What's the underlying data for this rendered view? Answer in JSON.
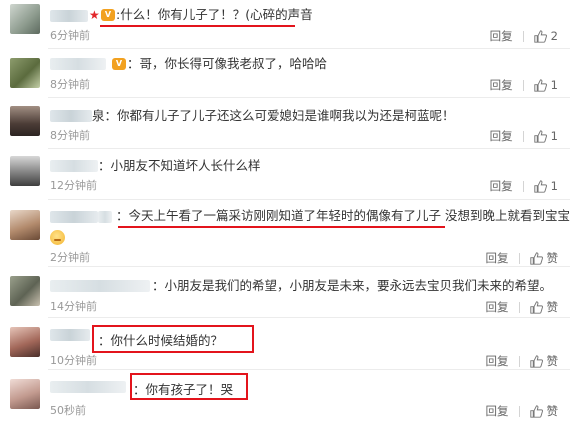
{
  "labels": {
    "reply": "回复",
    "like": "赞"
  },
  "colors": {
    "highlight": "#e3141c",
    "star": "#e2262a",
    "vip": "#f2a120",
    "meta": "#999999"
  },
  "comments": [
    {
      "text": ":什么！你有儿子了！？(心碎的声音",
      "time": "6分钟前",
      "likes": "2"
    },
    {
      "text": "：哥，你长得可像我老叔了，哈哈哈",
      "time": "8分钟前",
      "likes": "1"
    },
    {
      "text": "泉：你都有儿子了儿子还这么可爱媳妇是谁啊我以为还是柯蓝呢！",
      "time": "8分钟前",
      "likes": "1"
    },
    {
      "text": "：小朋友不知道坏人长什么样",
      "time": "12分钟前",
      "likes": "1"
    },
    {
      "text": "：今天上午看了一篇采访刚刚知道了年轻时的偶像有了儿子 没想到晚上就看到宝宝了",
      "time": "2分钟前",
      "likes": ""
    },
    {
      "text": "：小朋友是我们的希望，小朋友是未来，要永远去宝贝我们未来的希望。",
      "time": "14分钟前",
      "likes": ""
    },
    {
      "text": "：你什么时候结婚的？",
      "time": "10分钟前",
      "likes": ""
    },
    {
      "text": "：你有孩子了！哭",
      "time": "50秒前",
      "likes": ""
    }
  ]
}
